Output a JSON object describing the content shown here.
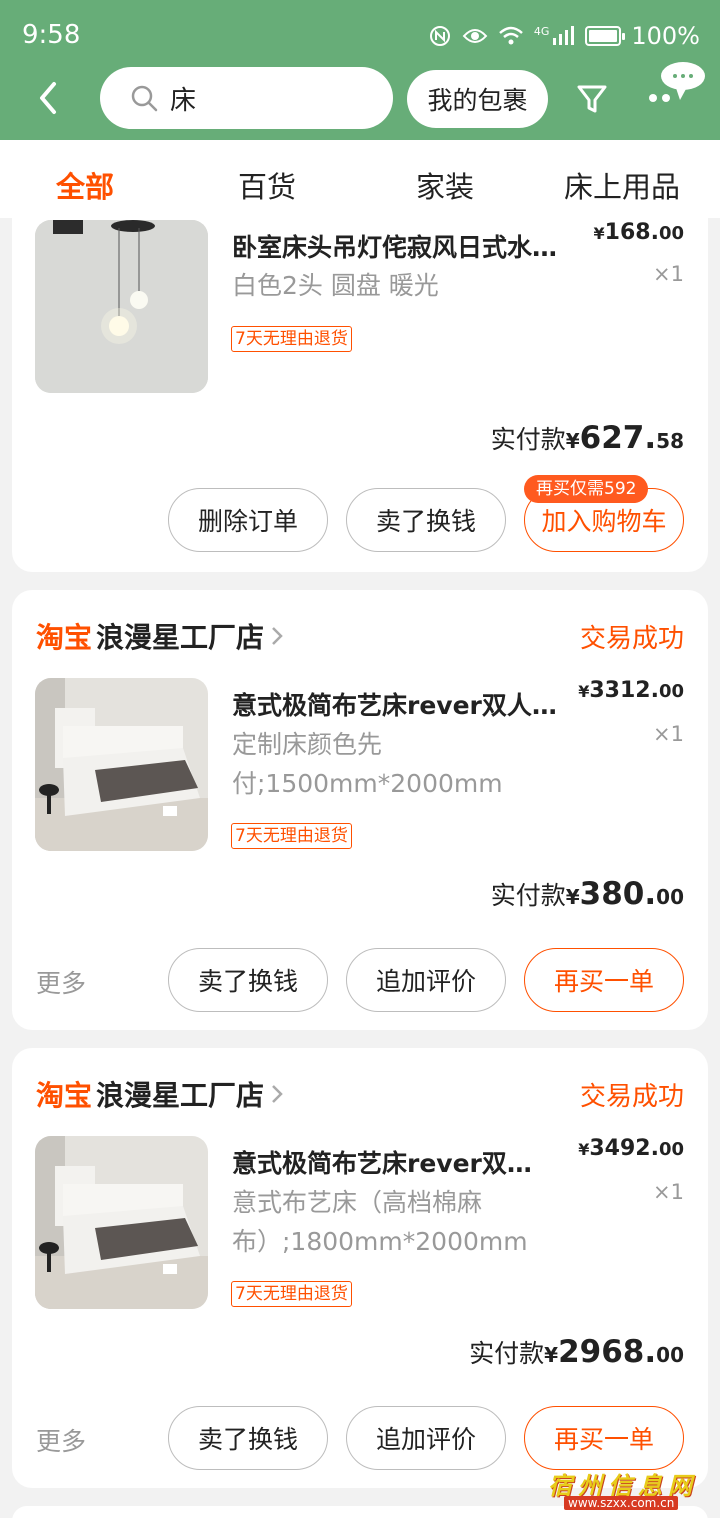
{
  "status_bar": {
    "time": "9:58",
    "network": "4G",
    "battery": "100%"
  },
  "header": {
    "search_query": "床",
    "package_button": "我的包裹"
  },
  "tabs": [
    {
      "label": "全部",
      "active": true
    },
    {
      "label": "百货",
      "active": false
    },
    {
      "label": "家装",
      "active": false
    },
    {
      "label": "床上用品",
      "active": false
    }
  ],
  "orders": [
    {
      "title": "卧室床头吊灯侘寂风日式水…",
      "spec_line1": "白色2头 圆盘 暖光",
      "tag": "7天无理由退货",
      "price": {
        "yen": "¥",
        "int": "168.",
        "dec": "00"
      },
      "qty": "×1",
      "paid": {
        "label": "实付款",
        "yen": "¥",
        "int": "627.",
        "dec": "58"
      },
      "buttons": [
        "删除订单",
        "卖了换钱",
        "加入购物车"
      ],
      "badge": "再买仅需592"
    },
    {
      "logo": "淘宝",
      "shop": "浪漫星工厂店",
      "status": "交易成功",
      "title": "意式极简布艺床rever双人…",
      "spec_line1": "定制床颜色先",
      "spec_line2": "付;1500mm*2000mm",
      "tag": "7天无理由退货",
      "price": {
        "yen": "¥",
        "int": "3312.",
        "dec": "00"
      },
      "qty": "×1",
      "paid": {
        "label": "实付款",
        "yen": "¥",
        "int": "380.",
        "dec": "00"
      },
      "more": "更多",
      "buttons": [
        "卖了换钱",
        "追加评价",
        "再买一单"
      ]
    },
    {
      "logo": "淘宝",
      "shop": "浪漫星工厂店",
      "status": "交易成功",
      "title": "意式极简布艺床rever双…",
      "spec_line1": "意式布艺床（高档棉麻",
      "spec_line2": "布）;1800mm*2000mm",
      "tag": "7天无理由退货",
      "price": {
        "yen": "¥",
        "int": "3492.",
        "dec": "00"
      },
      "qty": "×1",
      "paid": {
        "label": "实付款",
        "yen": "¥",
        "int": "2968.",
        "dec": "00"
      },
      "more": "更多",
      "buttons": [
        "卖了换钱",
        "追加评价",
        "再买一单"
      ]
    }
  ],
  "watermark": {
    "title": "宿州信息网",
    "url": "www.szxx.com.cn"
  },
  "colors": {
    "header_green": "#67ad78",
    "accent_orange": "#ff5000",
    "page_bg": "#f2f2f2"
  },
  "icons": [
    "back-arrow-icon",
    "search-icon",
    "filter-icon",
    "more-chat-icon",
    "chevron-right-icon",
    "wifi-icon",
    "signal-icon",
    "eye-icon",
    "nfc-icon",
    "battery-icon"
  ]
}
